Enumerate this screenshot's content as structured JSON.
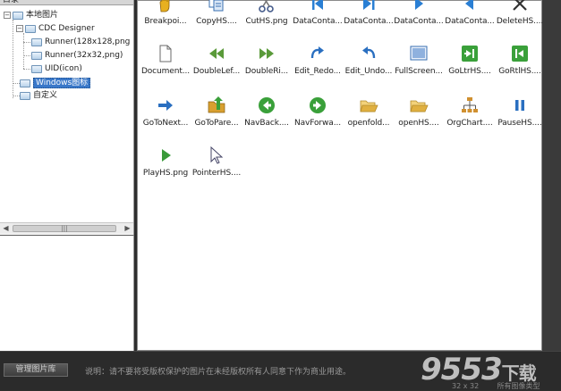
{
  "tree": {
    "header": "目录",
    "nodes": [
      {
        "label": "本地图片"
      },
      {
        "label": "CDC Designer"
      },
      {
        "label": "Runner(128x128,png"
      },
      {
        "label": "Runner(32x32,png)"
      },
      {
        "label": "UID(icon)"
      },
      {
        "label": "Windows图标"
      },
      {
        "label": "自定义"
      }
    ],
    "toggle_minus": "−",
    "scroll_left": "◀",
    "scroll_right": "▶",
    "scroll_grip": "|||"
  },
  "icons": [
    {
      "label": "Breakpoi...",
      "icon": "hand-icon",
      "color": "#e8b020"
    },
    {
      "label": "CopyHS....",
      "icon": "copy-icon",
      "color": "#3a6fb0"
    },
    {
      "label": "CutHS.png",
      "icon": "scissors-icon",
      "color": "#445a8a"
    },
    {
      "label": "DataConta...",
      "icon": "first-record-icon",
      "color": "#2a7fd4"
    },
    {
      "label": "DataConta...",
      "icon": "last-record-icon",
      "color": "#2a7fd4"
    },
    {
      "label": "DataConta...",
      "icon": "next-icon",
      "color": "#2a7fd4"
    },
    {
      "label": "DataConta...",
      "icon": "previous-icon",
      "color": "#2a7fd4"
    },
    {
      "label": "DeleteHS....",
      "icon": "delete-x-icon",
      "color": "#333333"
    },
    {
      "label": "Document...",
      "icon": "document-icon",
      "color": "#6a6a6a"
    },
    {
      "label": "DoubleLef...",
      "icon": "double-left-icon",
      "color": "#5a9a3a"
    },
    {
      "label": "DoubleRi...",
      "icon": "double-right-icon",
      "color": "#5a9a3a"
    },
    {
      "label": "Edit_Redo...",
      "icon": "redo-icon",
      "color": "#2a6fc0"
    },
    {
      "label": "Edit_Undo...",
      "icon": "undo-icon",
      "color": "#2a6fc0"
    },
    {
      "label": "FullScreen...",
      "icon": "fullscreen-icon",
      "color": "#3a6fb0"
    },
    {
      "label": "GoLtrHS....",
      "icon": "go-ltr-icon",
      "color": "#3aa03a"
    },
    {
      "label": "GoRtlHS....",
      "icon": "go-rtl-icon",
      "color": "#3aa03a"
    },
    {
      "label": "GoToNext...",
      "icon": "goto-next-icon",
      "color": "#2a6fc0"
    },
    {
      "label": "GoToPare...",
      "icon": "goto-parent-icon",
      "color": "#d8a030"
    },
    {
      "label": "NavBack....",
      "icon": "nav-back-icon",
      "color": "#3aa03a"
    },
    {
      "label": "NavForwa...",
      "icon": "nav-forward-icon",
      "color": "#3aa03a"
    },
    {
      "label": "openfold...",
      "icon": "open-folder-icon",
      "color": "#e0b040"
    },
    {
      "label": "openHS....",
      "icon": "open-folder-icon",
      "color": "#e0b040"
    },
    {
      "label": "OrgChart....",
      "icon": "org-chart-icon",
      "color": "#d09030"
    },
    {
      "label": "PauseHS....",
      "icon": "pause-icon",
      "color": "#2a6fc0"
    },
    {
      "label": "PlayHS.png",
      "icon": "play-icon",
      "color": "#3a9a3a"
    },
    {
      "label": "PointerHS....",
      "icon": "pointer-icon",
      "color": "#8aa0c0"
    }
  ],
  "bottom": {
    "manage_button": "管理图片库",
    "note": "说明：请不要将受版权保护的图片在未经版权所有人同意下作为商业用途。",
    "size_text": "32 x 32",
    "show_text": "所有图像类型",
    "watermark": "9553",
    "watermark_suffix": "下载"
  }
}
